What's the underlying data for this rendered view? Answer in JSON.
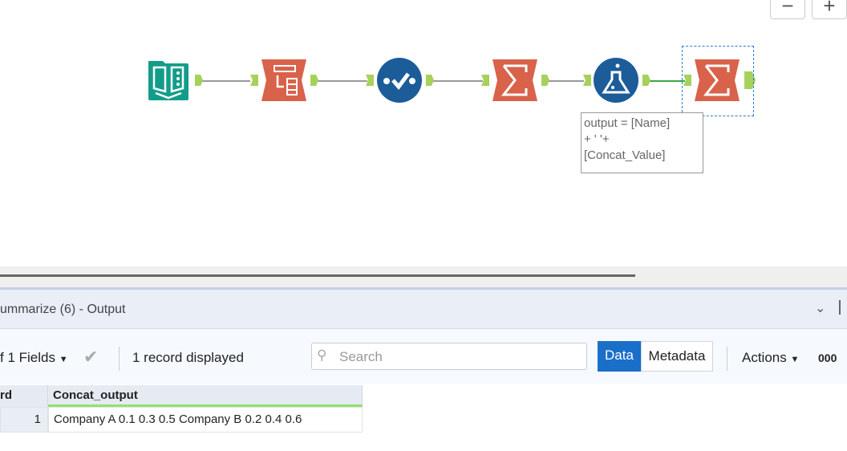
{
  "canvas": {
    "zoom_out_label": "−",
    "zoom_in_label": "+",
    "tools": [
      {
        "name": "input-data-tool",
        "color": "#139c8a"
      },
      {
        "name": "select-tool",
        "color": "#d9624a"
      },
      {
        "name": "data-cleansing-tool",
        "color": "#1b5c99"
      },
      {
        "name": "summarize-tool",
        "color": "#d9624a"
      },
      {
        "name": "formula-tool",
        "color": "#1b5c99"
      },
      {
        "name": "summarize-tool-selected",
        "color": "#d9624a"
      }
    ],
    "annotation": [
      "output = [Name]",
      "+ ' '+",
      "[Concat_Value]"
    ]
  },
  "results": {
    "title": "ummarize (6) - Output",
    "fields_label": "f 1 Fields",
    "record_count": "1 record displayed",
    "search_placeholder": "Search",
    "data_tab": "Data",
    "metadata_tab": "Metadata",
    "actions_label": "Actions",
    "number_format": "000",
    "columns": [
      "rd",
      "Concat_output"
    ],
    "rows": [
      [
        "1",
        "Company A 0.1 0.3 0.5 Company B 0.2 0.4 0.6"
      ]
    ]
  }
}
